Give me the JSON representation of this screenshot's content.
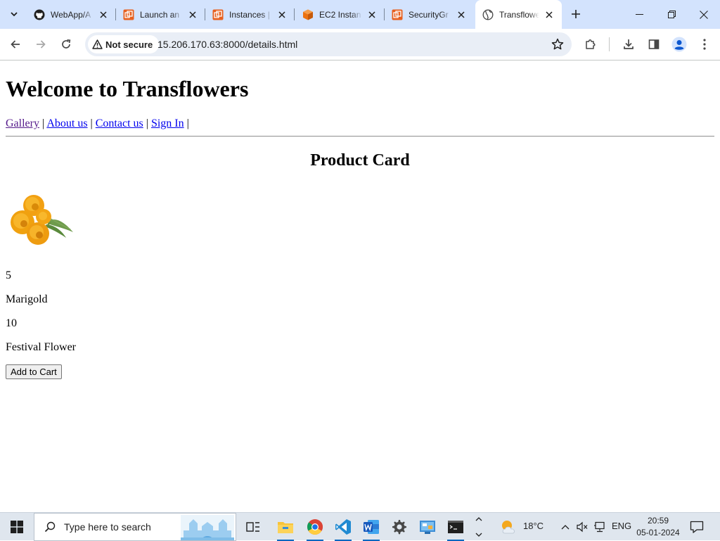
{
  "browser": {
    "tabs": [
      {
        "title": "WebApp/A",
        "favicon": "github-icon"
      },
      {
        "title": "Launch an",
        "favicon": "aws-console-icon"
      },
      {
        "title": "Instances |",
        "favicon": "aws-console-icon"
      },
      {
        "title": "EC2 Instan",
        "favicon": "ec2-icon"
      },
      {
        "title": "SecurityGr",
        "favicon": "aws-console-icon"
      },
      {
        "title": "Transflowe",
        "favicon": "globe-icon",
        "active": true
      }
    ],
    "security_label": "Not secure",
    "url": "15.206.170.63:8000/details.html",
    "colors": {
      "tabstrip": "#d3e3fd",
      "omnibox": "#e9eef6"
    }
  },
  "page": {
    "heading": "Welcome to Transflowers",
    "nav": [
      {
        "label": "Gallery"
      },
      {
        "label": "About us"
      },
      {
        "label": "Contact us"
      },
      {
        "label": "Sign In"
      }
    ],
    "nav_separator": "|",
    "card_title": "Product Card",
    "product": {
      "image": "marigold-flower-image",
      "id": "5",
      "name": "Marigold",
      "price": "10",
      "description": "Festival Flower"
    },
    "add_to_cart_label": "Add to Cart"
  },
  "taskbar": {
    "search_placeholder": "Type here to search",
    "weather_temp": "18°C",
    "language": "ENG",
    "time": "20:59",
    "date": "05-01-2024"
  }
}
